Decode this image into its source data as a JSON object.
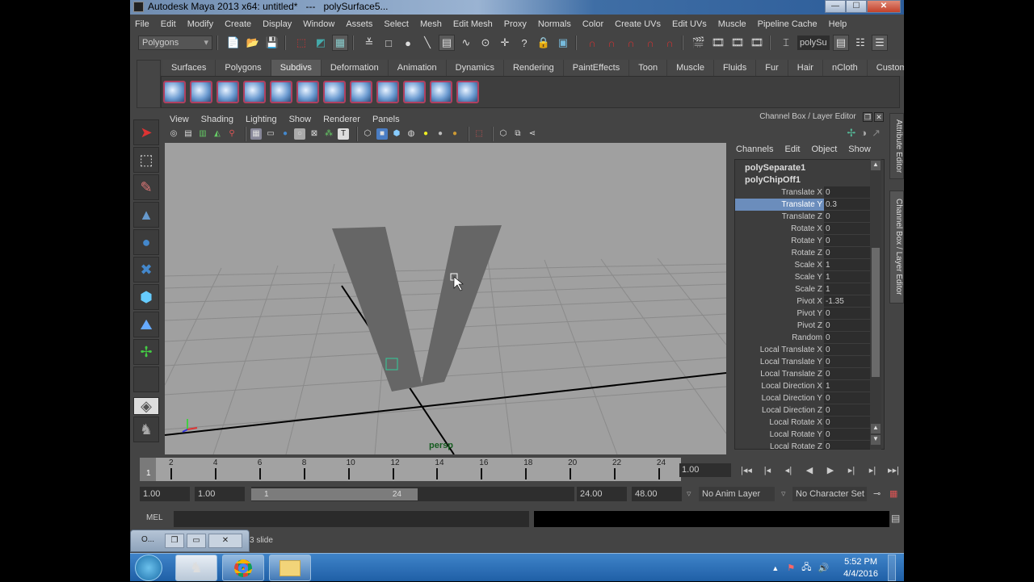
{
  "window": {
    "title": "Autodesk Maya 2013 x64: untitled*   ---   polySurface5...",
    "controls": {
      "minimize": "—",
      "maximize": "☐",
      "close": "✕"
    }
  },
  "menubar": [
    "File",
    "Edit",
    "Modify",
    "Create",
    "Display",
    "Window",
    "Assets",
    "Select",
    "Mesh",
    "Edit Mesh",
    "Proxy",
    "Normals",
    "Color",
    "Create UVs",
    "Edit UVs",
    "Muscle",
    "Pipeline Cache",
    "Help"
  ],
  "statusline": {
    "mode": "Polygons",
    "name_field": "polySu",
    "icons": [
      "new-scene-icon",
      "open-scene-icon",
      "save-scene-icon",
      "select-hierarchy-icon",
      "select-object-icon",
      "select-component-icon",
      "snap-grid-icon",
      "snap-curve-icon",
      "snap-point-icon",
      "snap-plane-icon",
      "history-icon",
      "render-icon",
      "ipr-icon",
      "render-settings-icon"
    ]
  },
  "shelf": {
    "tabs": [
      "Surfaces",
      "Polygons",
      "Subdivs",
      "Deformation",
      "Animation",
      "Dynamics",
      "Rendering",
      "PaintEffects",
      "Toon",
      "Muscle",
      "Fluids",
      "Fur",
      "Hair",
      "nCloth",
      "Custom"
    ],
    "active_tab": "Subdivs",
    "icon_count": 12
  },
  "toolbox": [
    "select-tool-icon",
    "lasso-tool-icon",
    "paint-select-icon",
    "move-tool-icon",
    "rotate-tool-icon",
    "scale-tool-icon",
    "manipulator-icon",
    "soft-mod-icon",
    "last-tool-icon",
    "empty-slot",
    "layout-icon",
    "outliner-icon"
  ],
  "viewport": {
    "menu": [
      "View",
      "Shading",
      "Lighting",
      "Show",
      "Renderer",
      "Panels"
    ],
    "camera_label": "persp"
  },
  "channel_box": {
    "title": "Channel Box / Layer Editor",
    "menu": [
      "Channels",
      "Edit",
      "Object",
      "Show"
    ],
    "objects": [
      "polySeparate1",
      "polyChipOff1"
    ],
    "channels": [
      {
        "label": "Translate X",
        "value": "0"
      },
      {
        "label": "Translate Y",
        "value": "0.3",
        "selected": true
      },
      {
        "label": "Translate Z",
        "value": "0"
      },
      {
        "label": "Rotate X",
        "value": "0"
      },
      {
        "label": "Rotate Y",
        "value": "0"
      },
      {
        "label": "Rotate Z",
        "value": "0"
      },
      {
        "label": "Scale X",
        "value": "1"
      },
      {
        "label": "Scale Y",
        "value": "1"
      },
      {
        "label": "Scale Z",
        "value": "1"
      },
      {
        "label": "Pivot X",
        "value": "-1.35"
      },
      {
        "label": "Pivot Y",
        "value": "0"
      },
      {
        "label": "Pivot Z",
        "value": "0"
      },
      {
        "label": "Random",
        "value": "0"
      },
      {
        "label": "Local Translate X",
        "value": "0"
      },
      {
        "label": "Local Translate Y",
        "value": "0"
      },
      {
        "label": "Local Translate Z",
        "value": "0"
      },
      {
        "label": "Local Direction X",
        "value": "1"
      },
      {
        "label": "Local Direction Y",
        "value": "0"
      },
      {
        "label": "Local Direction Z",
        "value": "0"
      },
      {
        "label": "Local Rotate X",
        "value": "0"
      },
      {
        "label": "Local Rotate Y",
        "value": "0"
      },
      {
        "label": "Local Rotate Z",
        "value": "0"
      }
    ],
    "side_tabs": [
      "Attribute Editor",
      "Channel Box / Layer Editor"
    ]
  },
  "timeline": {
    "current_frame_marker": "1",
    "ticks": [
      "2",
      "4",
      "6",
      "8",
      "10",
      "12",
      "14",
      "16",
      "18",
      "20",
      "22",
      "24"
    ],
    "current_time": "1.00",
    "playback": [
      "|◂◂",
      "|◂",
      "◂|",
      "◀",
      "▶",
      "▸|",
      "▸|",
      "▸▸|"
    ]
  },
  "range": {
    "start": "1.00",
    "playback_start": "1.00",
    "slider_start": "1",
    "slider_end": "24",
    "playback_end": "24.00",
    "end": "48.00",
    "anim_layer": "No Anim Layer",
    "character_set": "No Character Set"
  },
  "command_line": {
    "label": "MEL",
    "input": "",
    "result": ""
  },
  "help_line": "3 slide",
  "minimized_window": {
    "label": "O...",
    "btns": [
      "❐",
      "▭",
      "✕"
    ]
  },
  "taskbar": {
    "apps": [
      "maya-icon",
      "chrome-icon",
      "explorer-icon"
    ],
    "time": "5:52 PM",
    "date": "4/4/2016"
  }
}
